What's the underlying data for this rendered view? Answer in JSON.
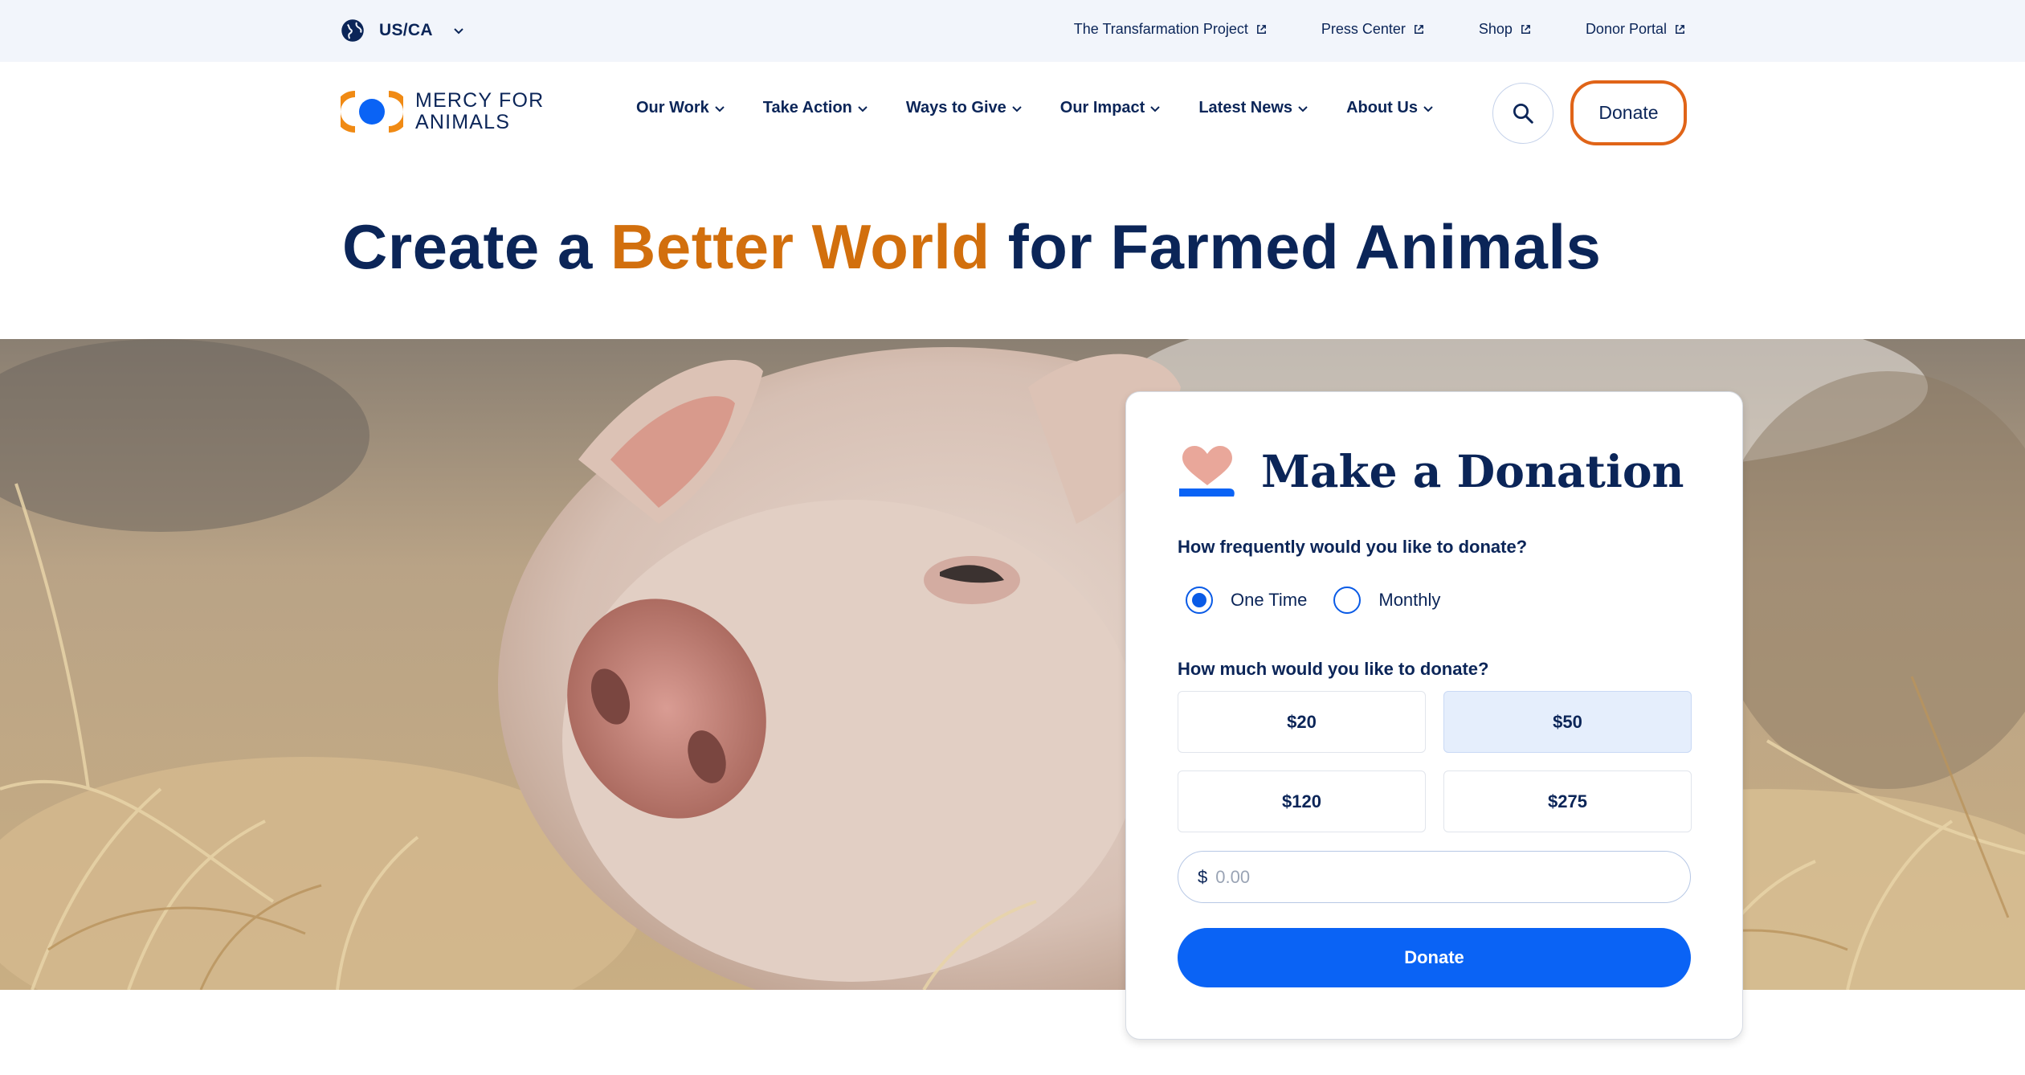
{
  "utility_bar": {
    "region_label": "US/CA",
    "links": [
      {
        "label": "The Transfarmation Project"
      },
      {
        "label": "Press Center"
      },
      {
        "label": "Shop"
      },
      {
        "label": "Donor Portal"
      }
    ]
  },
  "header": {
    "logo_line1": "MERCY FOR",
    "logo_line2": "ANIMALS",
    "nav": [
      {
        "label": "Our Work"
      },
      {
        "label": "Take Action"
      },
      {
        "label": "Ways to Give"
      },
      {
        "label": "Our Impact"
      },
      {
        "label": "Latest News"
      },
      {
        "label": "About Us"
      }
    ],
    "donate_label": "Donate"
  },
  "hero": {
    "headline_start": "Create a ",
    "headline_accent": "Better World",
    "headline_end": " for Farmed Animals"
  },
  "donation": {
    "title": "Make a Donation",
    "frequency_question": "How frequently would you like to donate?",
    "frequency_options": [
      {
        "label": "One Time",
        "selected": true
      },
      {
        "label": "Monthly",
        "selected": false
      }
    ],
    "amount_question": "How much would you like to donate?",
    "amounts": [
      {
        "label": "$20",
        "selected": false
      },
      {
        "label": "$50",
        "selected": true
      },
      {
        "label": "$120",
        "selected": false
      },
      {
        "label": "$275",
        "selected": false
      }
    ],
    "custom_currency": "$",
    "custom_placeholder": "0.00",
    "submit_label": "Donate"
  },
  "colors": {
    "navy": "#0b2558",
    "accent_orange": "#d26f0d",
    "primary_blue": "#0a63f5",
    "utility_bg": "#f2f5fb"
  },
  "icons": [
    "globe-icon",
    "chevron-down-icon",
    "external-link-icon",
    "search-icon",
    "heart-hand-icon"
  ]
}
